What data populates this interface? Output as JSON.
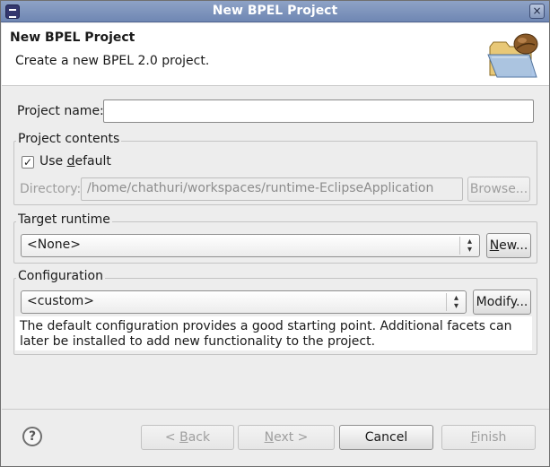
{
  "window": {
    "title": "New BPEL Project",
    "close_glyph": "×"
  },
  "header": {
    "title": "New BPEL Project",
    "description": "Create a new BPEL 2.0 project.",
    "icon": "folder-with-bean-icon"
  },
  "form": {
    "project_name_label": "Project name:",
    "project_name_value": "",
    "project_contents": {
      "group_label": "Project contents",
      "use_default_prefix": "Use ",
      "use_default_mnemonic": "d",
      "use_default_suffix": "efault",
      "use_default_checked": true,
      "directory_label": "Directory:",
      "directory_value": "/home/chathuri/workspaces/runtime-EclipseApplication",
      "browse_label": "Browse..."
    },
    "target_runtime": {
      "group_label": "Target runtime",
      "selected": "<None>",
      "new_prefix": "",
      "new_mnemonic": "N",
      "new_suffix": "ew..."
    },
    "configuration": {
      "group_label": "Configuration",
      "selected": "<custom>",
      "modify_label": "Modify...",
      "description": "The default configuration provides a good starting point. Additional facets can later be installed to add new functionality to the project."
    }
  },
  "footer": {
    "help_glyph": "?",
    "back_prefix": "< ",
    "back_mnemonic": "B",
    "back_suffix": "ack",
    "next_mnemonic": "N",
    "next_suffix": "ext >",
    "cancel_label": "Cancel",
    "finish_mnemonic": "F",
    "finish_suffix": "inish"
  },
  "colors": {
    "titlebar": "#7b91bb",
    "window_bg": "#ededed",
    "header_bg": "#ffffff",
    "disabled_text": "#9e9e9e"
  }
}
